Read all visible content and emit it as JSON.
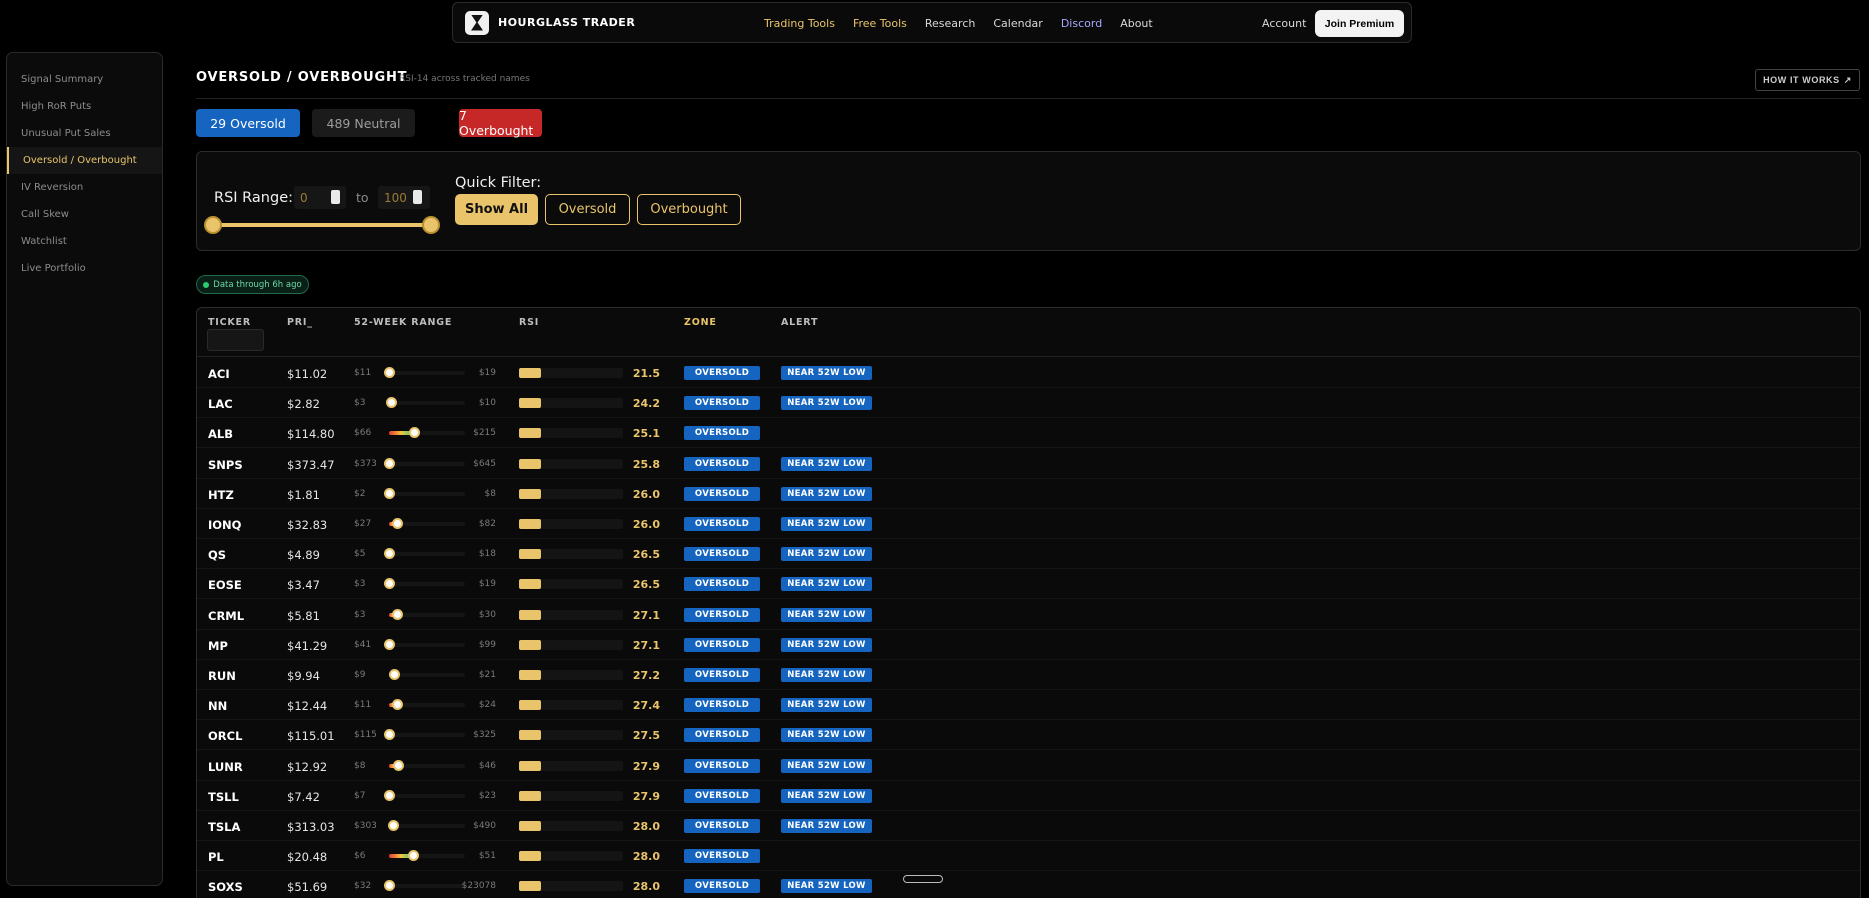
{
  "nav": {
    "brand": "HOURGLASS TRADER",
    "links": [
      {
        "label": "Trading Tools",
        "style": "gold"
      },
      {
        "label": "Free Tools",
        "style": "gold"
      },
      {
        "label": "Research",
        "style": "plain"
      },
      {
        "label": "Calendar",
        "style": "plain"
      },
      {
        "label": "Discord",
        "style": "purple"
      },
      {
        "label": "About",
        "style": "plain"
      }
    ],
    "account": "Account",
    "join": "Join Premium"
  },
  "sidebar": {
    "items": [
      {
        "label": "Signal Summary",
        "active": false
      },
      {
        "label": "High RoR Puts",
        "active": false
      },
      {
        "label": "Unusual Put Sales",
        "active": false
      },
      {
        "label": "Oversold / Overbought",
        "active": true
      },
      {
        "label": "IV Reversion",
        "active": false
      },
      {
        "label": "Call Skew",
        "active": false
      },
      {
        "label": "Watchlist",
        "active": false
      },
      {
        "label": "Live Portfolio",
        "active": false
      }
    ]
  },
  "header": {
    "title": "OVERSOLD / OVERBOUGHT",
    "subtitle": "RSI-14 across tracked names",
    "how_it_works": "HOW IT WORKS",
    "how_icon": "external-link-icon"
  },
  "summary": {
    "oversold": "29 Oversold",
    "neutral": "489 Neutral",
    "overbought": "7 Overbought"
  },
  "filter": {
    "rsi_label": "RSI Range:",
    "min": "0",
    "max": "100",
    "to": "to",
    "range_min": 0,
    "range_max": 100,
    "quick_label": "Quick Filter:",
    "show_all": "Show All",
    "oversold": "Oversold",
    "overbought": "Overbought"
  },
  "data_badge": "Data through 6h ago",
  "table": {
    "columns": {
      "ticker": "TICKER",
      "price": "PRI_",
      "range": "52-WEEK RANGE",
      "rsi": "RSI",
      "zone": "ZONE",
      "alert": "ALERT"
    },
    "rows": [
      {
        "ticker": "ACI",
        "price": "$11.02",
        "low": "$11",
        "high": "$19",
        "pos": 0.0,
        "rsi": "21.5",
        "zone": "OVERSOLD",
        "alert": "NEAR 52W LOW"
      },
      {
        "ticker": "LAC",
        "price": "$2.82",
        "low": "$3",
        "high": "$10",
        "pos": 0.02,
        "rsi": "24.2",
        "zone": "OVERSOLD",
        "alert": "NEAR 52W LOW"
      },
      {
        "ticker": "ALB",
        "price": "$114.80",
        "low": "$66",
        "high": "$215",
        "pos": 0.33,
        "rsi": "25.1",
        "zone": "OVERSOLD",
        "alert": ""
      },
      {
        "ticker": "SNPS",
        "price": "$373.47",
        "low": "$373",
        "high": "$645",
        "pos": 0.0,
        "rsi": "25.8",
        "zone": "OVERSOLD",
        "alert": "NEAR 52W LOW"
      },
      {
        "ticker": "HTZ",
        "price": "$1.81",
        "low": "$2",
        "high": "$8",
        "pos": 0.0,
        "rsi": "26.0",
        "zone": "OVERSOLD",
        "alert": "NEAR 52W LOW"
      },
      {
        "ticker": "IONQ",
        "price": "$32.83",
        "low": "$27",
        "high": "$82",
        "pos": 0.1,
        "rsi": "26.0",
        "zone": "OVERSOLD",
        "alert": "NEAR 52W LOW"
      },
      {
        "ticker": "QS",
        "price": "$4.89",
        "low": "$5",
        "high": "$18",
        "pos": 0.0,
        "rsi": "26.5",
        "zone": "OVERSOLD",
        "alert": "NEAR 52W LOW"
      },
      {
        "ticker": "EOSE",
        "price": "$3.47",
        "low": "$3",
        "high": "$19",
        "pos": 0.0,
        "rsi": "26.5",
        "zone": "OVERSOLD",
        "alert": "NEAR 52W LOW"
      },
      {
        "ticker": "CRML",
        "price": "$5.81",
        "low": "$3",
        "high": "$30",
        "pos": 0.1,
        "rsi": "27.1",
        "zone": "OVERSOLD",
        "alert": "NEAR 52W LOW"
      },
      {
        "ticker": "MP",
        "price": "$41.29",
        "low": "$41",
        "high": "$99",
        "pos": 0.0,
        "rsi": "27.1",
        "zone": "OVERSOLD",
        "alert": "NEAR 52W LOW"
      },
      {
        "ticker": "RUN",
        "price": "$9.94",
        "low": "$9",
        "high": "$21",
        "pos": 0.07,
        "rsi": "27.2",
        "zone": "OVERSOLD",
        "alert": "NEAR 52W LOW"
      },
      {
        "ticker": "NN",
        "price": "$12.44",
        "low": "$11",
        "high": "$24",
        "pos": 0.1,
        "rsi": "27.4",
        "zone": "OVERSOLD",
        "alert": "NEAR 52W LOW"
      },
      {
        "ticker": "ORCL",
        "price": "$115.01",
        "low": "$115",
        "high": "$325",
        "pos": 0.0,
        "rsi": "27.5",
        "zone": "OVERSOLD",
        "alert": "NEAR 52W LOW"
      },
      {
        "ticker": "LUNR",
        "price": "$12.92",
        "low": "$8",
        "high": "$46",
        "pos": 0.12,
        "rsi": "27.9",
        "zone": "OVERSOLD",
        "alert": "NEAR 52W LOW"
      },
      {
        "ticker": "TSLL",
        "price": "$7.42",
        "low": "$7",
        "high": "$23",
        "pos": 0.0,
        "rsi": "27.9",
        "zone": "OVERSOLD",
        "alert": "NEAR 52W LOW"
      },
      {
        "ticker": "TSLA",
        "price": "$313.03",
        "low": "$303",
        "high": "$490",
        "pos": 0.05,
        "rsi": "28.0",
        "zone": "OVERSOLD",
        "alert": "NEAR 52W LOW"
      },
      {
        "ticker": "PL",
        "price": "$20.48",
        "low": "$6",
        "high": "$51",
        "pos": 0.32,
        "rsi": "28.0",
        "zone": "OVERSOLD",
        "alert": ""
      },
      {
        "ticker": "SOXS",
        "price": "$51.69",
        "low": "$32",
        "high": "$23078",
        "pos": 0.0,
        "rsi": "28.0",
        "zone": "OVERSOLD",
        "alert": "NEAR 52W LOW"
      }
    ]
  },
  "colors": {
    "gold": "#e9c46a",
    "blue": "#1565c0",
    "red": "#c62828"
  }
}
